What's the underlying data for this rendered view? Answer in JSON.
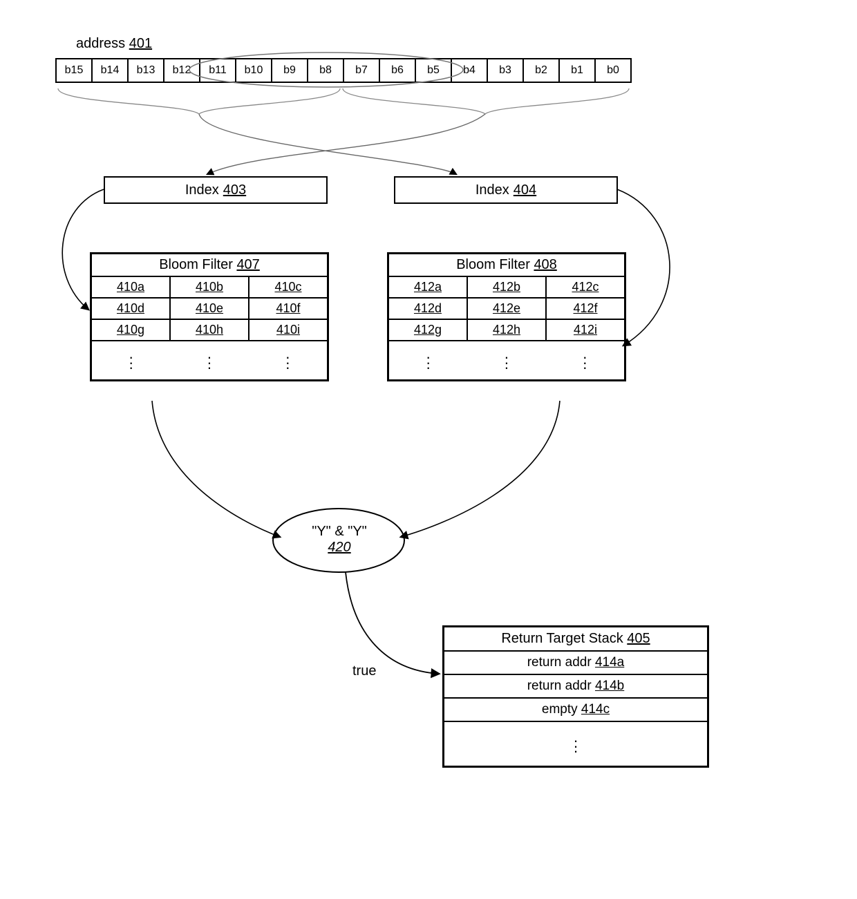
{
  "address": {
    "label": "address",
    "ref": "401",
    "bits": [
      "b15",
      "b14",
      "b13",
      "b12",
      "b11",
      "b10",
      "b9",
      "b8",
      "b7",
      "b6",
      "b5",
      "b4",
      "b3",
      "b2",
      "b1",
      "b0"
    ]
  },
  "index_left": {
    "label": "Index",
    "ref": "403"
  },
  "index_right": {
    "label": "Index",
    "ref": "404"
  },
  "bloom_left": {
    "title": "Bloom Filter",
    "ref": "407",
    "rows": [
      [
        "410a",
        "410b",
        "410c"
      ],
      [
        "410d",
        "410e",
        "410f"
      ],
      [
        "410g",
        "410h",
        "410i"
      ]
    ]
  },
  "bloom_right": {
    "title": "Bloom Filter",
    "ref": "408",
    "rows": [
      [
        "412a",
        "412b",
        "412c"
      ],
      [
        "412d",
        "412e",
        "412f"
      ],
      [
        "412g",
        "412h",
        "412i"
      ]
    ]
  },
  "and_node": {
    "label": "\"Y\" & \"Y\"",
    "ref": "420",
    "out_label": "true"
  },
  "rstack": {
    "title": "Return Target Stack",
    "ref": "405",
    "rows": [
      {
        "text": "return addr",
        "ref": "414a"
      },
      {
        "text": "return addr",
        "ref": "414b"
      },
      {
        "text": "empty",
        "ref": "414c"
      }
    ]
  }
}
